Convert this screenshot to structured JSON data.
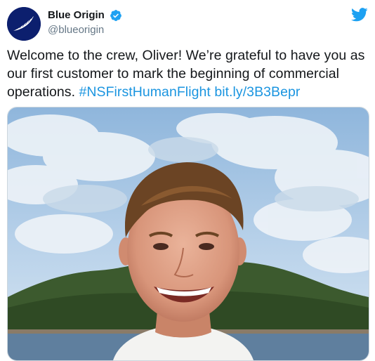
{
  "author": {
    "display_name": "Blue Origin",
    "handle": "@blueorigin",
    "verified": true,
    "avatar_icon": "feather-logo-icon",
    "avatar_color": "#0c1f6e"
  },
  "tweet": {
    "text_plain": "Welcome to the crew, Oliver! We’re grateful to have you as our first customer to mark the beginning of commercial operations. ",
    "hashtag": "#NSFirstHumanFlight",
    "link": "bit.ly/3B3Bepr",
    "link_color": "#1b95e0"
  },
  "platform_icon": "twitter-bird-icon",
  "media": {
    "type": "photo",
    "scene": "young man smiling in front of a green hill by the sea"
  }
}
